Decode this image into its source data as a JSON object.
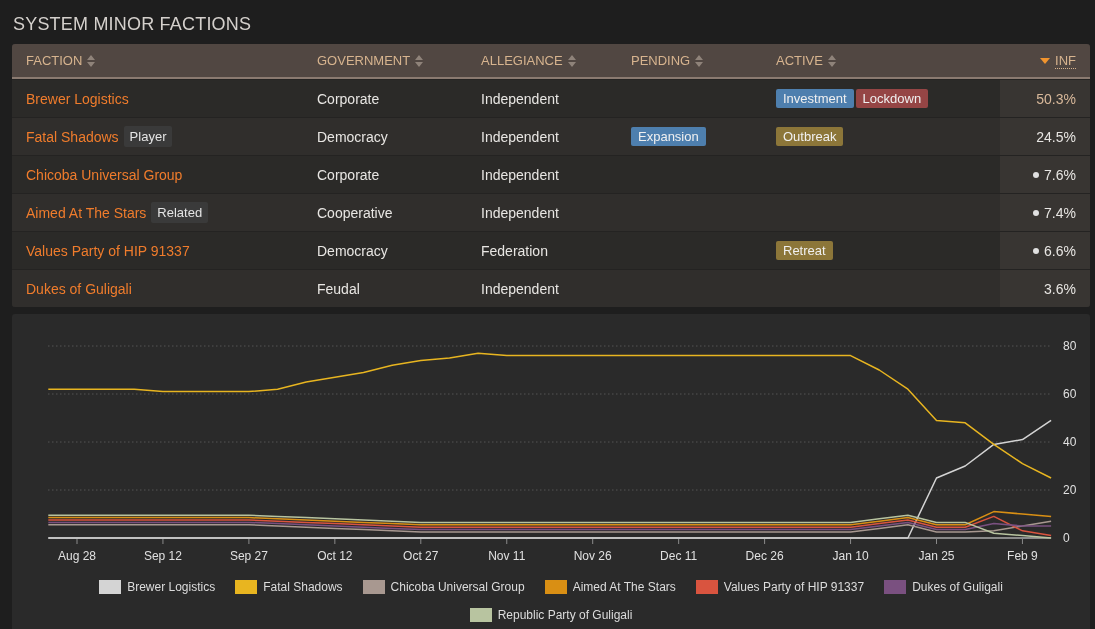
{
  "title": "SYSTEM MINOR FACTIONS",
  "table": {
    "columns": [
      {
        "label": "FACTION",
        "sorted": false
      },
      {
        "label": "GOVERNMENT",
        "sorted": false
      },
      {
        "label": "ALLEGIANCE",
        "sorted": false
      },
      {
        "label": "PENDING",
        "sorted": false
      },
      {
        "label": "ACTIVE",
        "sorted": false
      },
      {
        "label": "INF",
        "sorted": true
      }
    ],
    "rows": [
      {
        "faction": "Brewer Logistics",
        "government": "Corporate",
        "allegiance": "Independent",
        "pending": [],
        "active": [
          {
            "label": "Investment",
            "color": "#4e7fae"
          },
          {
            "label": "Lockdown",
            "color": "#954545"
          }
        ],
        "influence": "50.3%",
        "highlighted": true,
        "marker": false
      },
      {
        "faction": "Fatal Shadows",
        "tag": "Player",
        "government": "Democracy",
        "allegiance": "Independent",
        "pending": [
          {
            "label": "Expansion",
            "color": "#4e7fae"
          }
        ],
        "active": [
          {
            "label": "Outbreak",
            "color": "#8c7639"
          }
        ],
        "influence": "24.5%",
        "highlighted": false,
        "marker": false
      },
      {
        "faction": "Chicoba Universal Group",
        "government": "Corporate",
        "allegiance": "Independent",
        "pending": [],
        "active": [],
        "influence": "7.6%",
        "highlighted": false,
        "marker": true
      },
      {
        "faction": "Aimed At The Stars",
        "tag": "Related",
        "government": "Cooperative",
        "allegiance": "Independent",
        "pending": [],
        "active": [],
        "influence": "7.4%",
        "highlighted": false,
        "marker": true
      },
      {
        "faction": "Values Party of HIP 91337",
        "government": "Democracy",
        "allegiance": "Federation",
        "pending": [],
        "active": [
          {
            "label": "Retreat",
            "color": "#8c7639"
          }
        ],
        "influence": "6.6%",
        "highlighted": false,
        "marker": true
      },
      {
        "faction": "Dukes of Guligali",
        "government": "Feudal",
        "allegiance": "Independent",
        "pending": [],
        "active": [],
        "influence": "3.6%",
        "highlighted": false,
        "marker": false
      }
    ]
  },
  "chart": {
    "chart_data": {
      "type": "line",
      "categories": [
        null,
        "Aug 28",
        null,
        null,
        "Sep 12",
        null,
        null,
        "Sep 27",
        null,
        null,
        "Oct 12",
        null,
        null,
        "Oct 27",
        null,
        null,
        "Nov 11",
        null,
        null,
        "Nov 26",
        null,
        null,
        "Dec 11",
        null,
        null,
        "Dec 26",
        null,
        null,
        "Jan 10",
        null,
        null,
        "Jan 25",
        null,
        null,
        "Feb 9",
        null
      ],
      "ylim": [
        0,
        80
      ],
      "grid": true,
      "legend": true,
      "yticks": [
        0,
        20,
        40,
        60,
        80
      ],
      "series": [
        {
          "name": "Brewer Logistics",
          "color": "#d4d4d4",
          "values": [
            0,
            0,
            0,
            0,
            0,
            0,
            0,
            0,
            0,
            0,
            0,
            0,
            0,
            0,
            0,
            0,
            0,
            0,
            0,
            0,
            0,
            0,
            0,
            0,
            0,
            0,
            0,
            0,
            0,
            0,
            0,
            25,
            30,
            39,
            41,
            49
          ]
        },
        {
          "name": "Fatal Shadows",
          "color": "#e8b520",
          "values": [
            62,
            62,
            62,
            62,
            61,
            61,
            61,
            61,
            62,
            65,
            67,
            69,
            72,
            74,
            75,
            77,
            76,
            76,
            76,
            76,
            76,
            76,
            76,
            76,
            76,
            76,
            76,
            76,
            76,
            70,
            62,
            49,
            48,
            39,
            31,
            25
          ]
        },
        {
          "name": "Chicoba Universal Group",
          "color": "#a89890",
          "values": [
            5.5,
            5.5,
            5.5,
            5.5,
            5.5,
            5.5,
            5.5,
            5.5,
            5,
            4.5,
            4,
            3.5,
            3,
            2.5,
            2.5,
            2.5,
            2.5,
            2.5,
            2.5,
            2.5,
            2.5,
            2.5,
            2.5,
            2.5,
            2.5,
            2.5,
            2.5,
            2.5,
            2.5,
            4,
            5.5,
            2.5,
            2.5,
            3,
            5,
            7
          ]
        },
        {
          "name": "Aimed At The Stars",
          "color": "#d98f14",
          "values": [
            8.5,
            8.5,
            8.5,
            8.5,
            8.5,
            8.5,
            8.5,
            8.5,
            8,
            7.5,
            7,
            6.5,
            6,
            5.5,
            5.5,
            5.5,
            5.5,
            5.5,
            5.5,
            5.5,
            5.5,
            5.5,
            5.5,
            5.5,
            5.5,
            5.5,
            5.5,
            5.5,
            5.5,
            7,
            8.5,
            5.5,
            5.5,
            11,
            10,
            9
          ]
        },
        {
          "name": "Values Party of HIP 91337",
          "color": "#d9543f",
          "values": [
            7.5,
            7.5,
            7.5,
            7.5,
            7.5,
            7.5,
            7.5,
            7.5,
            7,
            6.5,
            6,
            5.5,
            5,
            4.5,
            4.5,
            4.5,
            4.5,
            4.5,
            4.5,
            4.5,
            4.5,
            4.5,
            4.5,
            4.5,
            4.5,
            4.5,
            4.5,
            4.5,
            4.5,
            6,
            7.5,
            4.5,
            4.5,
            9,
            3,
            1
          ]
        },
        {
          "name": "Dukes of Guligali",
          "color": "#7a5080",
          "values": [
            6.5,
            6.5,
            6.5,
            6.5,
            6.5,
            6.5,
            6.5,
            6.5,
            6,
            5.5,
            5,
            4.5,
            4,
            3.5,
            3.5,
            3.5,
            3.5,
            3.5,
            3.5,
            3.5,
            3.5,
            3.5,
            3.5,
            3.5,
            3.5,
            3.5,
            3.5,
            3.5,
            3.5,
            5,
            6.5,
            3.5,
            3.5,
            6,
            5,
            5
          ]
        },
        {
          "name": "Republic Party of Guligali",
          "color": "#b8c4a0",
          "values": [
            9.5,
            9.5,
            9.5,
            9.5,
            9.5,
            9.5,
            9.5,
            9.5,
            9,
            8.5,
            8,
            7.5,
            7,
            6.5,
            6.5,
            6.5,
            6.5,
            6.5,
            6.5,
            6.5,
            6.5,
            6.5,
            6.5,
            6.5,
            6.5,
            6.5,
            6.5,
            6.5,
            6.5,
            8,
            9.5,
            6.5,
            6.5,
            2,
            1,
            0
          ]
        }
      ]
    }
  }
}
